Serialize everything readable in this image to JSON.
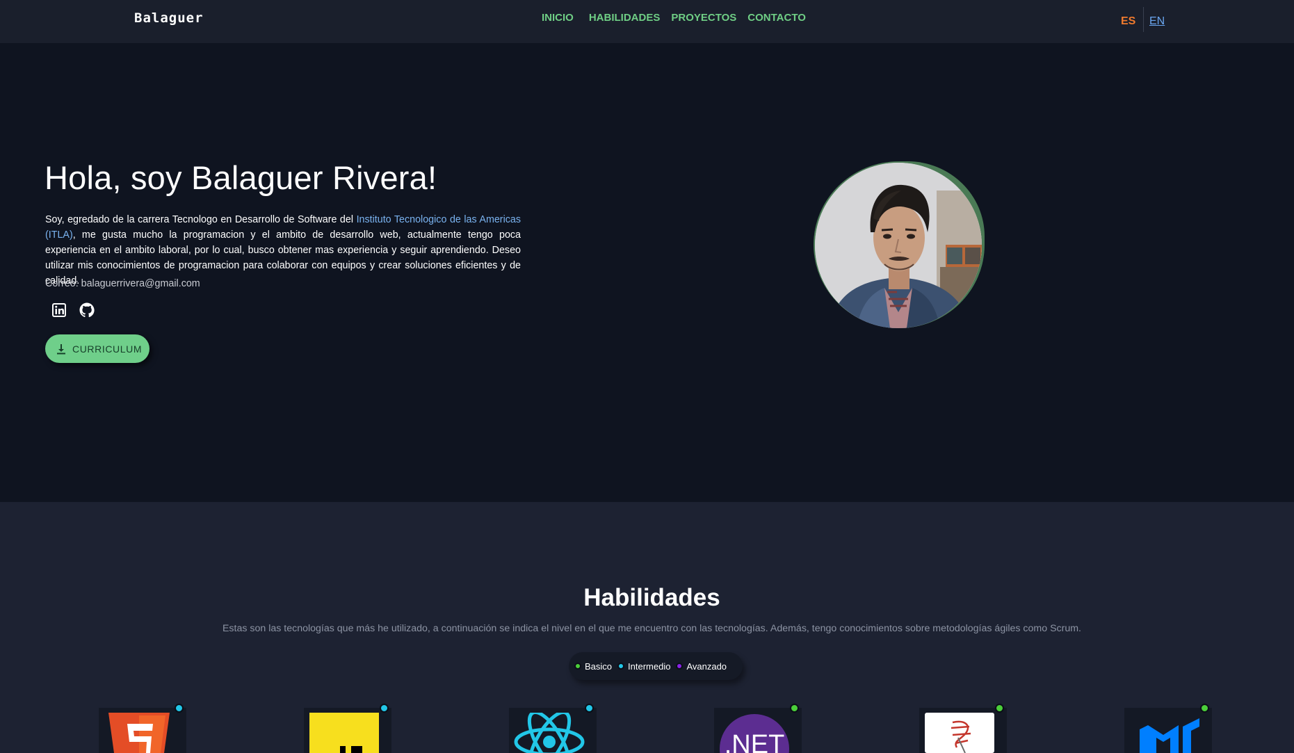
{
  "nav": {
    "brand": "Balaguer",
    "links": [
      "INICIO",
      "HABILIDADES",
      "PROYECTOS",
      "CONTACTO"
    ],
    "lang_es": "ES",
    "lang_en": "EN",
    "colors": {
      "link": "#6fce85",
      "active_lang": "#f07a2e",
      "inactive_lang": "#6aa6f0"
    }
  },
  "hero": {
    "title": "Hola, soy Balaguer Rivera!",
    "desc_before": "Soy, egredado de la carrera Tecnologo en Desarrollo de Software del ",
    "desc_link": "Instituto Tecnologico de las Americas (ITLA)",
    "desc_after": ", me gusta mucho la programacion y el ambito de desarrollo web, actualmente tengo poca experiencia en el ambito laboral, por lo cual, busco obtener mas experiencia y seguir aprendiendo. Deseo utilizar mis conocimientos de programacion para colaborar con equipos y crear soluciones eficientes y de calidad.",
    "email": "Correo: balaguerrivera@gmail.com",
    "social": [
      "linkedin-icon",
      "github-icon"
    ],
    "cv_button": "CURRICULUM",
    "avatar": "profile-photo"
  },
  "skills": {
    "title": "Habilidades",
    "subtitle": "Estas son las tecnologías que más he utilizado, a continuación se indica el nivel en el que me encuentro con las tecnologías. Además, tengo conocimientos sobre metodologías ágiles como Scrum.",
    "legend": [
      {
        "label": "Basico",
        "color": "#4bcf3a"
      },
      {
        "label": "Intermedio",
        "color": "#22c7e8"
      },
      {
        "label": "Avanzado",
        "color": "#8a22e8"
      }
    ],
    "items": [
      {
        "icon": "html5-icon",
        "level_color": "#22c7e8"
      },
      {
        "icon": "javascript-icon",
        "level_color": "#22c7e8"
      },
      {
        "icon": "react-icon",
        "level_color": "#22c7e8"
      },
      {
        "icon": "dotnet-icon",
        "level_color": "#4bcf3a"
      },
      {
        "icon": "sql-server-icon",
        "level_color": "#4bcf3a"
      },
      {
        "icon": "material-ui-icon",
        "level_color": "#4bcf3a"
      }
    ]
  }
}
